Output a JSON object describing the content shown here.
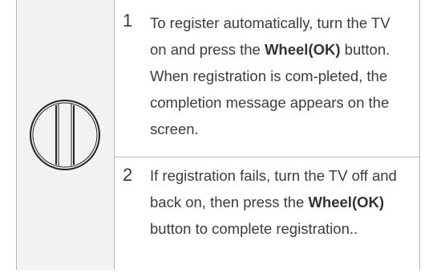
{
  "icon": {
    "name": "wheel-button-icon"
  },
  "steps": [
    {
      "number": "1",
      "text_before": "To register automatically, turn the TV on and press the ",
      "bold": "Wheel(OK)",
      "text_after": " button. When registration is com-pleted, the completion message appears on the screen."
    },
    {
      "number": "2",
      "text_before": "If registration fails, turn the TV off and back on, then press the ",
      "bold": "Wheel(OK)",
      "text_after": " button to complete registration.."
    }
  ]
}
